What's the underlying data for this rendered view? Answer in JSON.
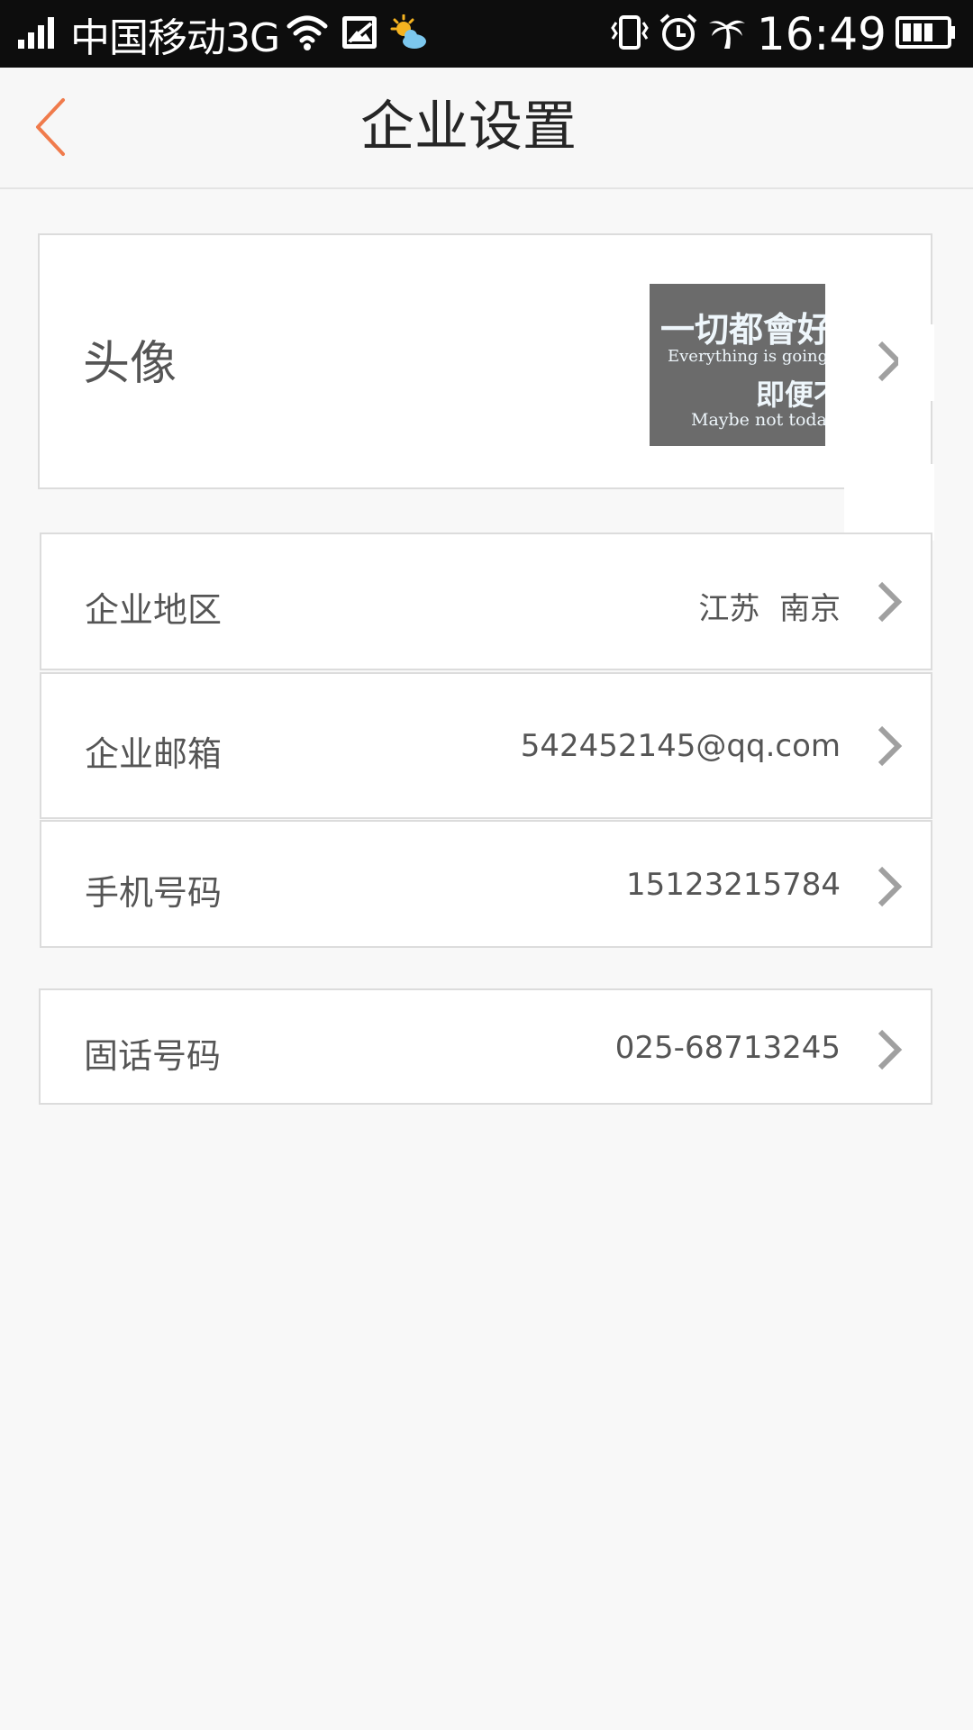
{
  "status_bar": {
    "carrier": "中国移动3G",
    "time": "16:49",
    "icons": [
      "signal-icon",
      "wifi-icon",
      "image-notification-icon",
      "weather-icon",
      "vibrate-icon",
      "alarm-icon",
      "status-palm-icon",
      "battery-icon"
    ]
  },
  "nav": {
    "title": "企业设置",
    "back_icon": "chevron-left-icon",
    "accent_color": "#f07b4c"
  },
  "avatar_row": {
    "label": "头像",
    "image_text": {
      "line1": "一切都會好",
      "line2": "Everything is going",
      "line3": "即便不",
      "line4": "Maybe not today"
    }
  },
  "rows": [
    {
      "label": "企业地区",
      "value": "江苏  南京"
    },
    {
      "label": "企业邮箱",
      "value": "542452145@qq.com"
    },
    {
      "label": "手机号码",
      "value": "15123215784"
    },
    {
      "label": "固话号码",
      "value": "025-68713245"
    }
  ]
}
